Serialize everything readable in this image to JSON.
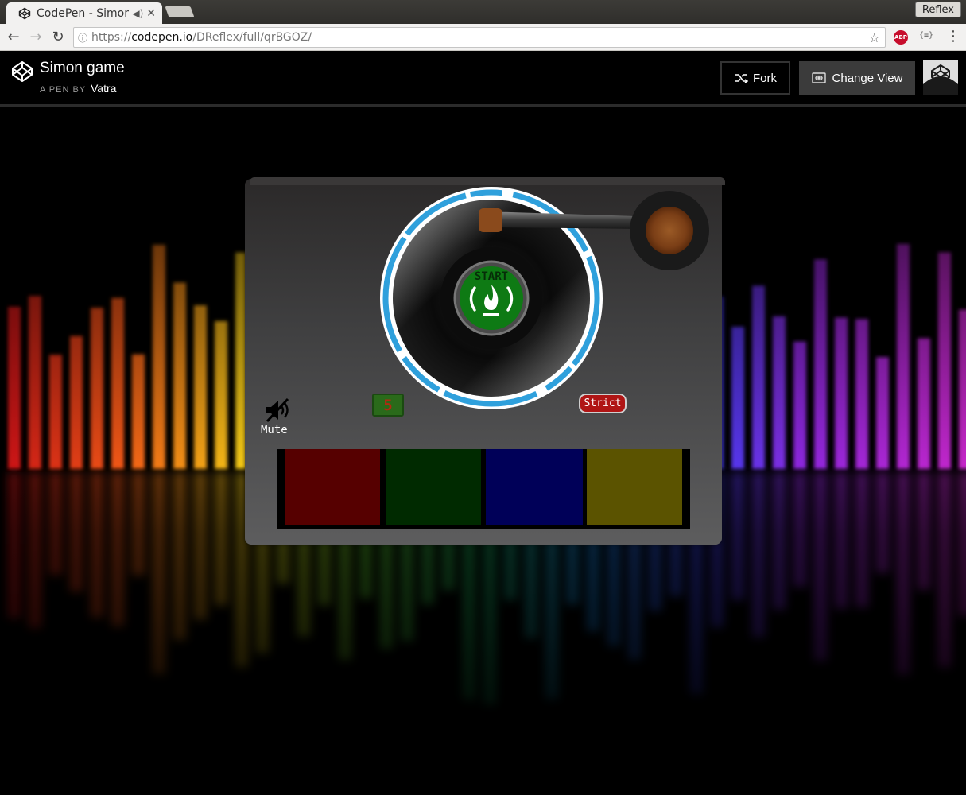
{
  "browser": {
    "tab_title": "CodePen - Simon game",
    "profile_name": "Reflex",
    "url_scheme": "https://",
    "url_host": "codepen.io",
    "url_path": "/DReflex/full/qrBGOZ/",
    "abp_label": "ABP",
    "json_ext_label": "{≡}"
  },
  "codepen": {
    "pen_title": "Simon game",
    "pen_by_label": "A PEN BY",
    "author": "Vatra",
    "fork_label": "Fork",
    "change_view_label": "Change View"
  },
  "game": {
    "start_label": "START",
    "count": "5",
    "strict_label": "Strict",
    "mute_label": "Mute",
    "pad_colors": [
      "#560000",
      "#002a00",
      "#000058",
      "#5b5300"
    ],
    "accent_green": "#0e7a14",
    "disc_ring_blue": "#2fa0dc"
  }
}
